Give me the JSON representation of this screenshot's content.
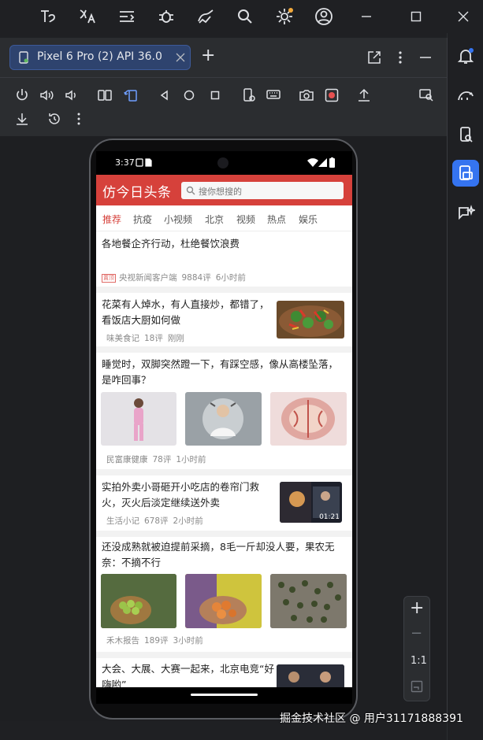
{
  "window": {
    "toolbar_icons": [
      "text-tool-icon",
      "translate-icon",
      "list-icon",
      "bug-icon",
      "analytics-icon",
      "search-icon",
      "settings-icon",
      "account-icon"
    ],
    "minimize_icon": "minimize-icon",
    "maximize_icon": "maximize-icon",
    "close_icon": "close-icon"
  },
  "emulator": {
    "device_tab": "Pixel 6 Pro (2) API 36.0",
    "new_tab": "+"
  },
  "phone": {
    "status": {
      "time": "3:37"
    },
    "app": {
      "title": "仿今日头条",
      "search_placeholder": "搜你想搜的",
      "tabs": [
        "推荐",
        "抗疫",
        "小视频",
        "北京",
        "视频",
        "热点",
        "娱乐"
      ],
      "active_tab": 0
    },
    "articles": [
      {
        "title": "各地餐企齐行动，杜绝餐饮浪费",
        "tag": "置顶",
        "source": "央视新闻客户端",
        "comments": "9884评",
        "time": "6小时前"
      },
      {
        "title": "花菜有人焯水，有人直接炒，都错了，看饭店大厨如何做",
        "source": "味美食记",
        "comments": "18评",
        "time": "刚刚"
      },
      {
        "title": "睡觉时，双脚突然蹬一下，有踩空感，像从高楼坠落，是咋回事？",
        "source": "民富康健康",
        "comments": "78评",
        "time": "1小时前"
      },
      {
        "title": "实拍外卖小哥砸开小吃店的卷帘门救火，灭火后淡定继续送外卖",
        "source": "生活小记",
        "comments": "678评",
        "time": "2小时前",
        "duration": "01:21"
      },
      {
        "title": "还没成熟就被迫提前采摘，8毛一斤却没人要，果农无奈：不摘不行",
        "source": "禾木报告",
        "comments": "189评",
        "time": "3小时前"
      },
      {
        "title": "大会、大展、大赛一起来，北京电竞“好嗨哟”"
      }
    ]
  },
  "zoom": {
    "plus": "+",
    "minus": "−",
    "ratio": "1:1"
  },
  "watermark": "掘金技术社区 @ 用户31171888391",
  "colors": {
    "accent": "#3574f0",
    "app_red": "#d6413b",
    "panel": "#2b2d30"
  }
}
